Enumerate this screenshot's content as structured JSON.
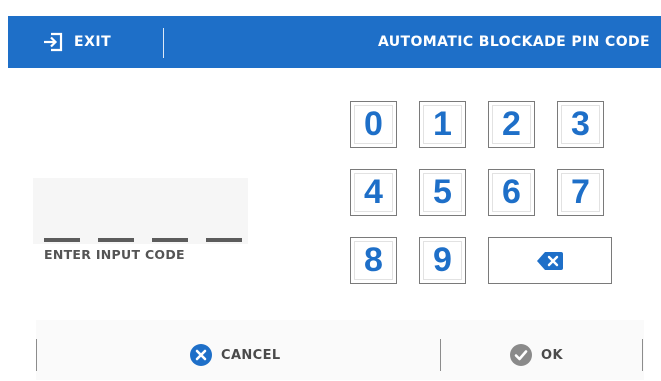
{
  "header": {
    "exit_label": "EXIT",
    "title": "AUTOMATIC BLOCKADE PIN CODE",
    "exit_icon": "exit-icon"
  },
  "code_entry": {
    "label": "ENTER INPUT CODE",
    "slots": 4
  },
  "keypad": {
    "keys": [
      "0",
      "1",
      "2",
      "3",
      "4",
      "5",
      "6",
      "7",
      "8",
      "9"
    ],
    "backspace_icon": "backspace-icon"
  },
  "footer": {
    "cancel_label": "CANCEL",
    "cancel_icon": "close-circle-icon",
    "ok_label": "OK",
    "ok_icon": "check-circle-icon"
  },
  "colors": {
    "accent": "#1e6fc8",
    "header_text": "#ffffff",
    "ok_icon": "#8a8a8a"
  }
}
